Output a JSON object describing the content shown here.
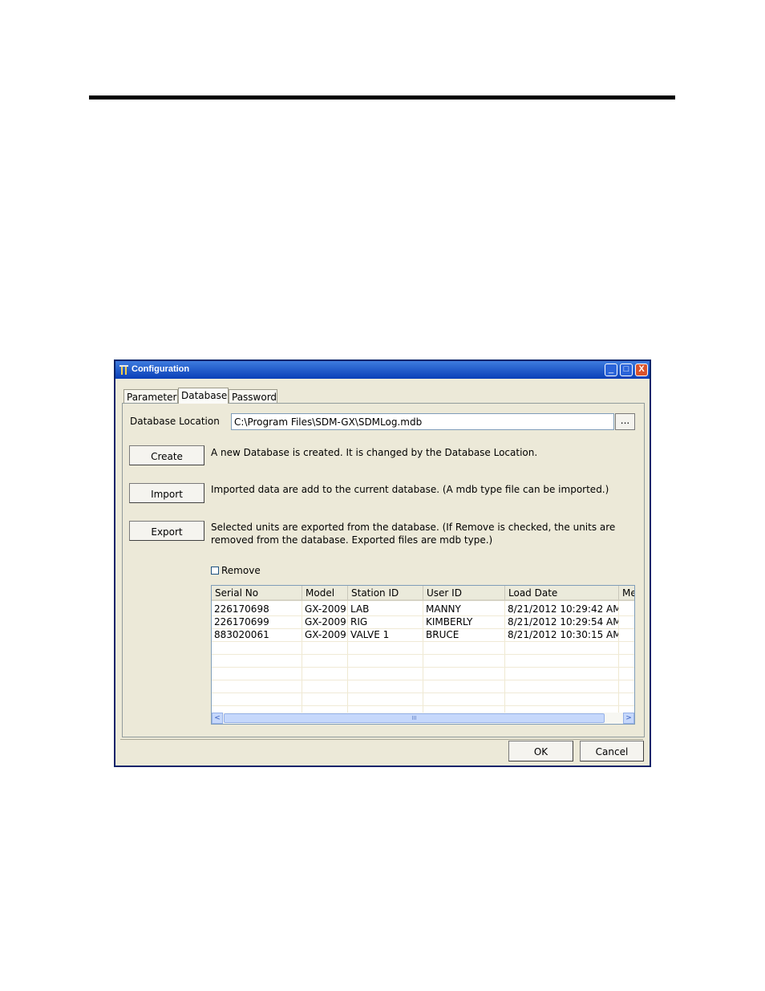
{
  "window": {
    "title": "Configuration",
    "buttons": {
      "minimize": "_",
      "maximize": "□",
      "close": "X"
    }
  },
  "tabs": [
    "Parameter",
    "Database",
    "Password"
  ],
  "active_tab": "Database",
  "database": {
    "location_label": "Database Location",
    "location_value": "C:\\Program Files\\SDM-GX\\SDMLog.mdb",
    "browse_label": "...",
    "create_label": "Create",
    "create_desc": "A new Database is created. It is changed by the Database Location.",
    "import_label": "Import",
    "import_desc": "Imported data are add to the current database. (A mdb type file can be imported.)",
    "export_label": "Export",
    "export_desc_line1": "Selected units are exported from the database. (If Remove is checked, the units are",
    "export_desc_line2": "removed from the database. Exported files are mdb type.)",
    "remove_label": "Remove",
    "remove_checked": false
  },
  "table": {
    "columns": [
      "Serial No",
      "Model",
      "Station ID",
      "User ID",
      "Load Date",
      "Me"
    ],
    "rows": [
      [
        "226170698",
        "GX-2009",
        "LAB",
        "MANNY",
        "8/21/2012 10:29:42 AM",
        ""
      ],
      [
        "226170699",
        "GX-2009",
        "RIG",
        "KIMBERLY",
        "8/21/2012 10:29:54 AM",
        ""
      ],
      [
        "883020061",
        "GX-2009",
        "VALVE 1",
        "BRUCE",
        "8/21/2012 10:30:15 AM",
        ""
      ]
    ],
    "scroll_left": "<",
    "scroll_right": ">",
    "scroll_grip": "III"
  },
  "footer": {
    "ok_label": "OK",
    "cancel_label": "Cancel"
  }
}
